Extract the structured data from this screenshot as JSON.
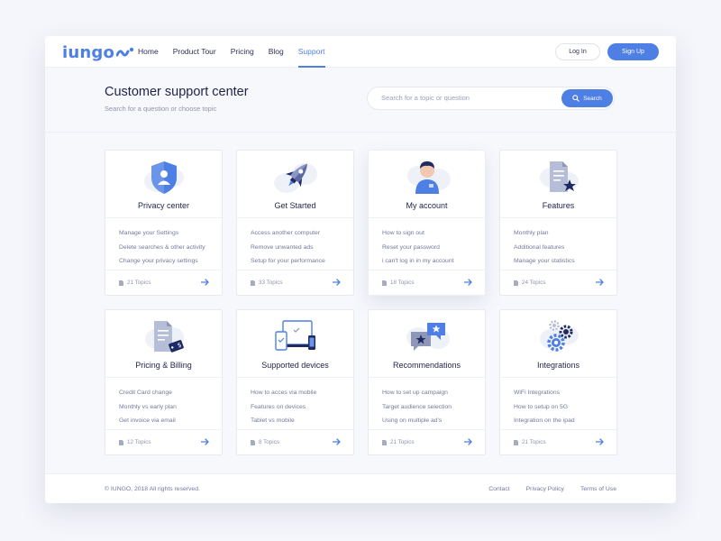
{
  "brand": {
    "name": "iungo",
    "accent": "#4d7fe4",
    "dark": "#1f2247"
  },
  "nav": {
    "items": [
      {
        "label": "Home",
        "active": false
      },
      {
        "label": "Product Tour",
        "active": false
      },
      {
        "label": "Pricing",
        "active": false
      },
      {
        "label": "Blog",
        "active": false
      },
      {
        "label": "Support",
        "active": true
      }
    ],
    "login_label": "Log In",
    "signup_label": "Sign Up"
  },
  "hero": {
    "title": "Customer support center",
    "subtitle": "Search for a question or choose topic",
    "search_placeholder": "Search for a topic or question",
    "search_button": "Search"
  },
  "cards": [
    {
      "title": "Privacy center",
      "icon": "shield-user-icon",
      "links": [
        "Manage your Settings",
        "Delete searches & other activity",
        "Change your privacy settings"
      ],
      "topics": "21 Topics"
    },
    {
      "title": "Get Started",
      "icon": "rocket-icon",
      "links": [
        "Access another computer",
        "Remove unwanted ads",
        "Setup for your performance"
      ],
      "topics": "33 Topics"
    },
    {
      "title": "My account",
      "icon": "user-avatar-icon",
      "links": [
        "How to sign out",
        "Reset your password",
        "i can't log in in my account"
      ],
      "topics": "18 Topics"
    },
    {
      "title": "Features",
      "icon": "document-star-icon",
      "links": [
        "Monthly plan",
        "Additional features",
        "Manage your statistics"
      ],
      "topics": "24 Topics"
    },
    {
      "title": "Pricing & Billing",
      "icon": "invoice-tag-icon",
      "links": [
        "Credit Card change",
        "Monthly vs early plan",
        "Get invoice via email"
      ],
      "topics": "12 Topics"
    },
    {
      "title": "Supported devices",
      "icon": "devices-icon",
      "links": [
        "How to acces via mobile",
        "Features on devices",
        "Tablet vs mobile"
      ],
      "topics": "8 Topics"
    },
    {
      "title": "Recommendations",
      "icon": "chat-star-icon",
      "links": [
        "How to set up campaign",
        "Target audience selection",
        "Using on multiple ad's"
      ],
      "topics": "21 Topics"
    },
    {
      "title": "Integrations",
      "icon": "gears-icon",
      "links": [
        "WiFi Integrations",
        "How to setup on 5G",
        "Integration on the ipad"
      ],
      "topics": "21 Topics"
    }
  ],
  "footer": {
    "copyright": "© IUNGO, 2018 All rights reserved.",
    "links": [
      "Contact",
      "Privacy Policy",
      "Terms of Use"
    ]
  }
}
